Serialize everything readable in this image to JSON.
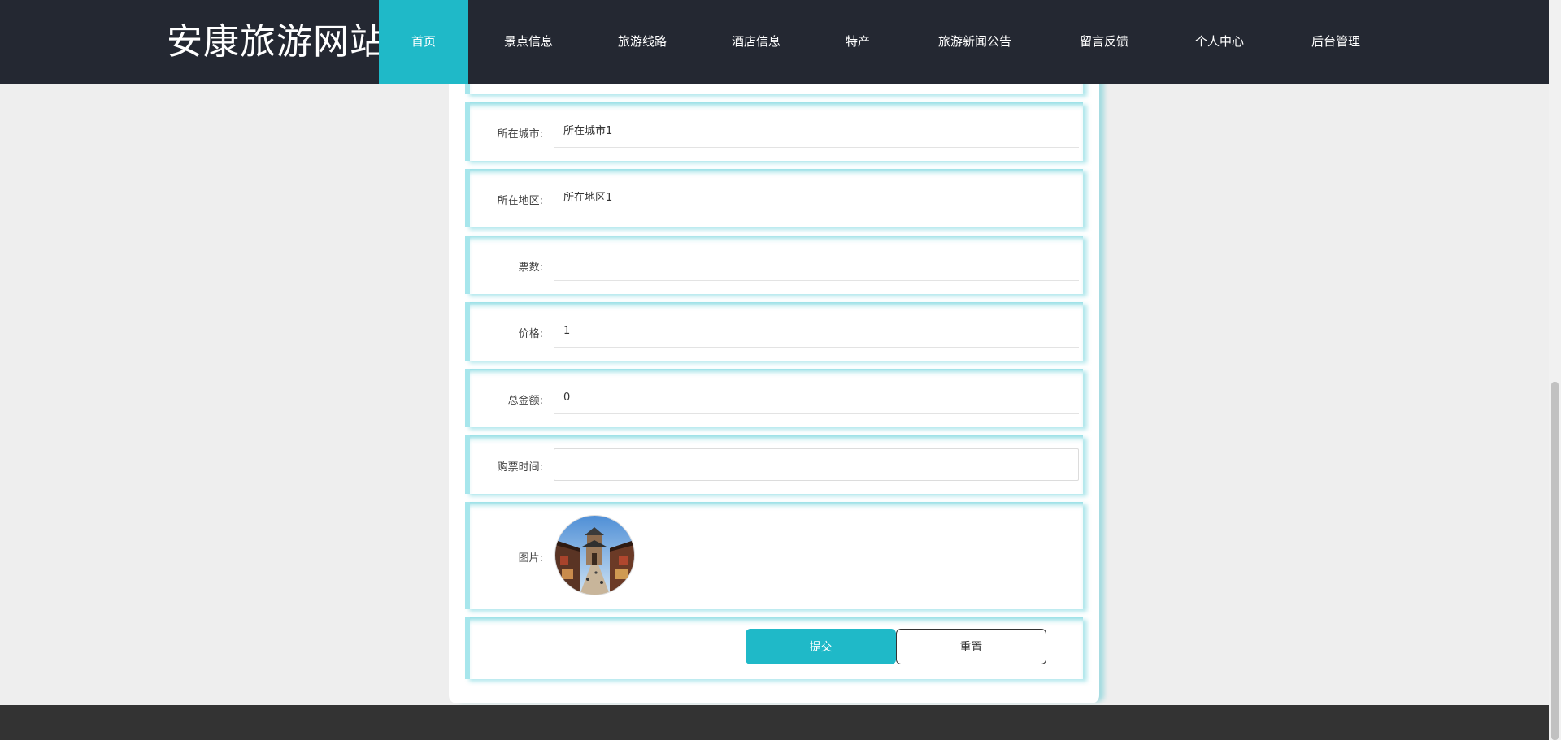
{
  "site": {
    "title": "安康旅游网站"
  },
  "nav": {
    "items": [
      {
        "label": "首页",
        "active": true
      },
      {
        "label": "景点信息"
      },
      {
        "label": "旅游线路"
      },
      {
        "label": "酒店信息"
      },
      {
        "label": "特产"
      },
      {
        "label": "旅游新闻公告"
      },
      {
        "label": "留言反馈"
      },
      {
        "label": "个人中心"
      },
      {
        "label": "后台管理"
      }
    ]
  },
  "form": {
    "city": {
      "label": "所在城市:",
      "value": "所在城市1"
    },
    "district": {
      "label": "所在地区:",
      "value": "所在地区1"
    },
    "tickets": {
      "label": "票数:",
      "value": ""
    },
    "price": {
      "label": "价格:",
      "value": "1"
    },
    "total": {
      "label": "总金额:",
      "value": "0"
    },
    "purchase_time": {
      "label": "购票时间:",
      "value": ""
    },
    "image": {
      "label": "图片:"
    },
    "submit_label": "提交",
    "reset_label": "重置"
  },
  "colors": {
    "accent": "#1fb9c8",
    "header_bg": "#242832",
    "footer_bg": "#333333",
    "page_bg": "#eeeeee"
  }
}
